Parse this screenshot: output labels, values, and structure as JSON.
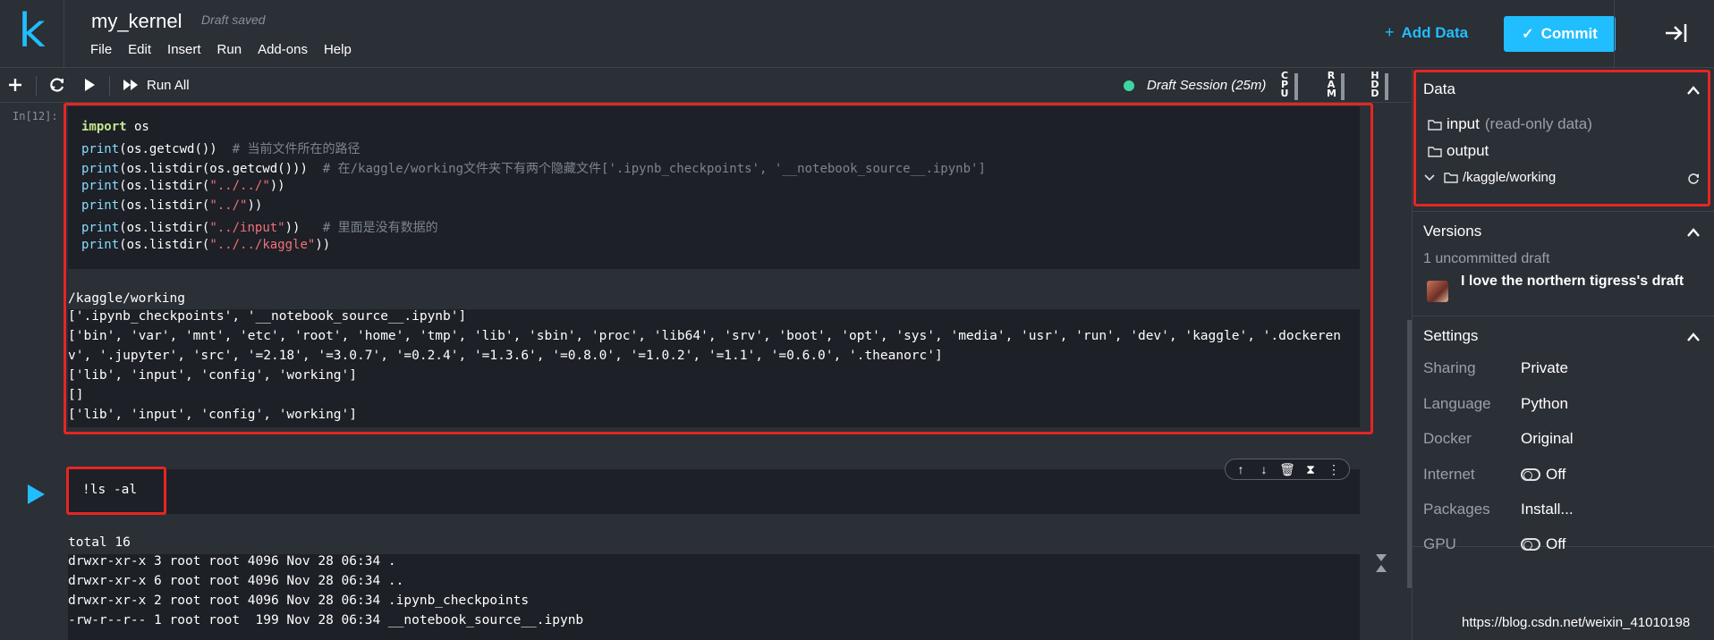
{
  "header": {
    "logo": "k",
    "kernel_title": "my_kernel",
    "draft_status": "Draft saved",
    "menu": [
      "File",
      "Edit",
      "Insert",
      "Run",
      "Add-ons",
      "Help"
    ],
    "add_data": "Add Data",
    "commit": "Commit"
  },
  "toolbar": {
    "run_all": "Run All",
    "session": "Draft Session (25m)",
    "session_color": "#3dd6a3",
    "meters": [
      "CPU",
      "RAM",
      "HDD"
    ]
  },
  "cell1": {
    "prompt": "In[12]:",
    "code": [
      {
        "a": "import",
        "b": " os",
        "c": "",
        "d": ""
      },
      {
        "a": "print",
        "b": "(os.getcwd())",
        "c": "  # 当前文件所在的路径",
        "d": ""
      },
      {
        "a": "print",
        "b": "(os.listdir(os.getcwd()))",
        "c": "  # 在/kaggle/working文件夹下有两个隐藏文件['.ipynb_checkpoints', '__notebook_source__.ipynb']",
        "d": ""
      },
      {
        "a": "print",
        "b": "(os.listdir(",
        "s": "\"../../\"",
        "e": "))"
      },
      {
        "a": "print",
        "b": "(os.listdir(",
        "s": "\"../\"",
        "e": "))"
      },
      {
        "a": "print",
        "b": "(os.listdir(",
        "s": "\"../input\"",
        "e": "))",
        "c": "   # 里面是没有数据的"
      },
      {
        "a": "print",
        "b": "(os.listdir(",
        "s": "\"../../kaggle\"",
        "e": "))"
      }
    ],
    "output": [
      "/kaggle/working",
      "['.ipynb_checkpoints', '__notebook_source__.ipynb']",
      "['bin', 'var', 'mnt', 'etc', 'root', 'home', 'tmp', 'lib', 'sbin', 'proc', 'lib64', 'srv', 'boot', 'opt', 'sys', 'media', 'usr', 'run', 'dev', 'kaggle', '.dockeren",
      "v', '.jupyter', 'src', '=2.18', '=3.0.7', '=0.2.4', '=1.3.6', '=0.8.0', '=1.0.2', '=1.1', '=0.6.0', '.theanorc']",
      "['lib', 'input', 'config', 'working']",
      "[]",
      "['lib', 'input', 'config', 'working']"
    ]
  },
  "cell2": {
    "code": "!ls -al",
    "output": [
      "total 16",
      "drwxr-xr-x 3 root root 4096 Nov 28 06:34 .",
      "drwxr-xr-x 6 root root 4096 Nov 28 06:34 ..",
      "drwxr-xr-x 2 root root 4096 Nov 28 06:34 .ipynb_checkpoints",
      "-rw-r--r-- 1 root root  199 Nov 28 06:34 __notebook_source__.ipynb"
    ]
  },
  "panel": {
    "data": {
      "title": "Data",
      "input": "input",
      "input_note": "(read-only data)",
      "output": "output",
      "working": "/kaggle/working"
    },
    "versions": {
      "title": "Versions",
      "uncommitted": "1 uncommitted draft",
      "draft_name": "I love the northern tigress's draft"
    },
    "settings": {
      "title": "Settings",
      "rows": [
        {
          "key": "Sharing",
          "value": "Private"
        },
        {
          "key": "Language",
          "value": "Python"
        },
        {
          "key": "Docker",
          "value": "Original"
        },
        {
          "key": "Internet",
          "value": "Off"
        },
        {
          "key": "Packages",
          "value": "Install..."
        },
        {
          "key": "GPU",
          "value": "Off"
        }
      ]
    }
  },
  "watermark": "https://blog.csdn.net/weixin_41010198",
  "colors": {
    "accent": "#20beff",
    "highlight": "#e52622",
    "background": "#2b2f36",
    "cell_bg": "#1d2026"
  }
}
